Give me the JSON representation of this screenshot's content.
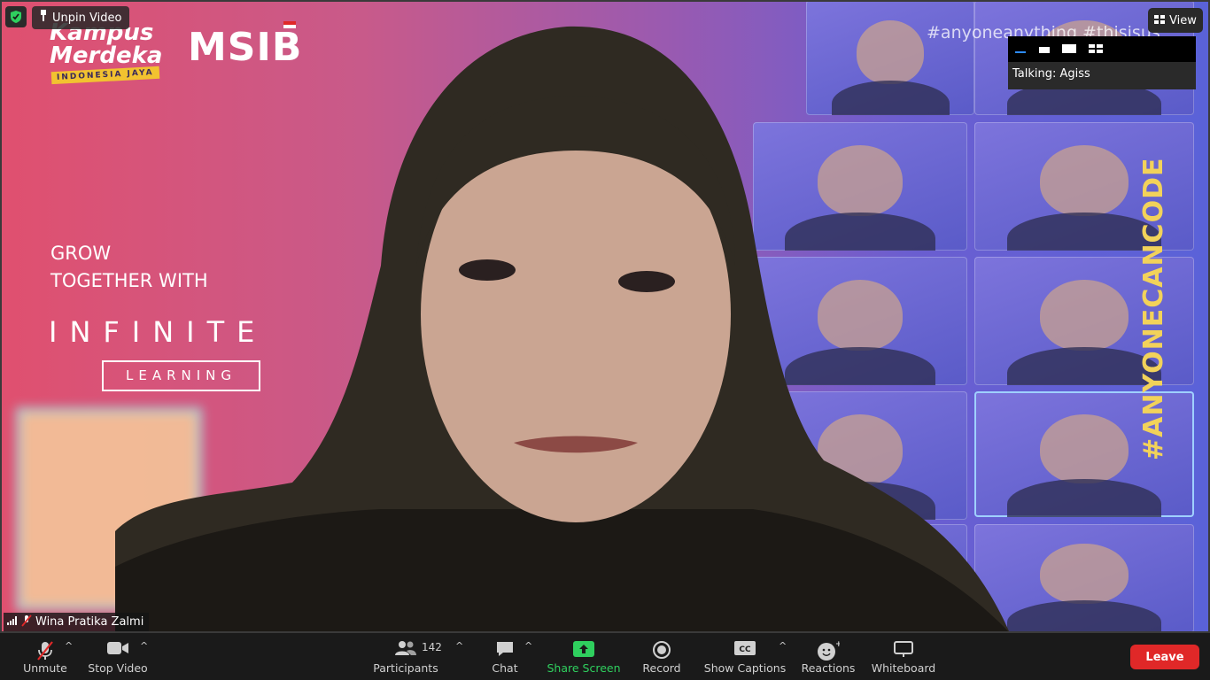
{
  "video": {
    "unpin_label": "Unpin Video",
    "view_label": "View",
    "talking": "Talking: Agiss",
    "participant_name": "Wina Pratika Zalmi",
    "background": {
      "logo_kampus_line1": "Kampus",
      "logo_kampus_line2": "Merdeka",
      "logo_kampus_sub": "INDONESIA JAYA",
      "logo_msib": "MSIB",
      "grow_line1": "GROW",
      "grow_line2": "TOGETHER WITH",
      "infinite": "INFINITE",
      "learning": "LEARNING",
      "hashtag_top": "#anyoneanything  #thisisus",
      "hashtag_vertical": "#ANYONECANCODE"
    }
  },
  "toolbar": {
    "unmute": "Unmute",
    "stop_video": "Stop Video",
    "participants": "Participants",
    "participants_count": "142",
    "chat": "Chat",
    "share_screen": "Share Screen",
    "record": "Record",
    "show_captions": "Show Captions",
    "reactions": "Reactions",
    "whiteboard": "Whiteboard",
    "leave": "Leave"
  },
  "colors": {
    "share_green": "#2fcf5e",
    "leave_red": "#e02828",
    "hashtag_yellow": "#f2d25a"
  }
}
